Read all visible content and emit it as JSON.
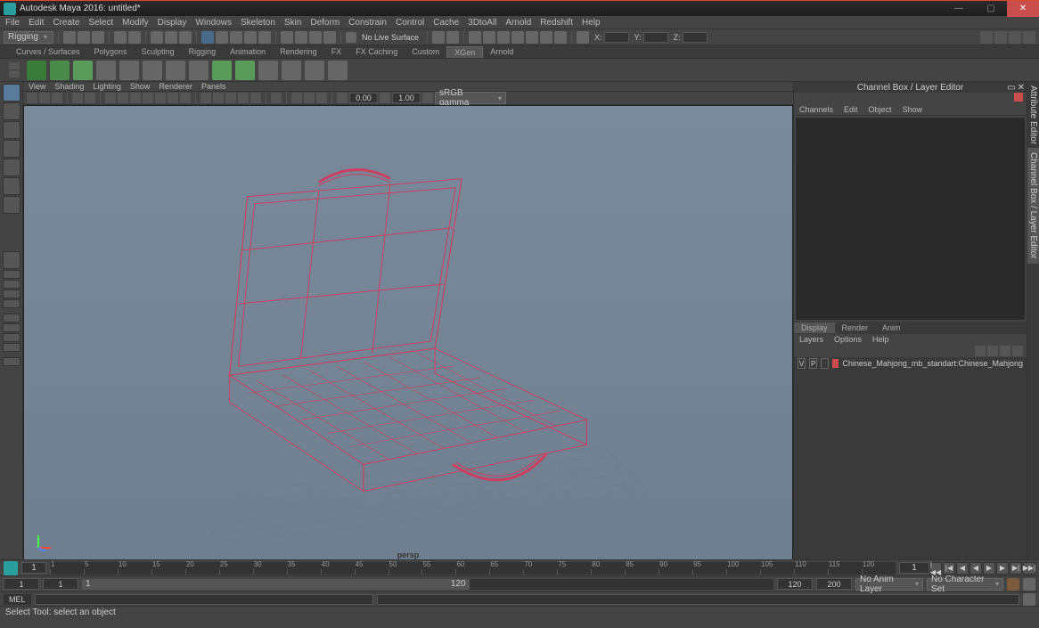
{
  "title": "Autodesk Maya 2016: untitled*",
  "menus": [
    "File",
    "Edit",
    "Create",
    "Select",
    "Modify",
    "Display",
    "Windows",
    "Skeleton",
    "Skin",
    "Deform",
    "Constrain",
    "Control",
    "Cache",
    "3DtoAll",
    "Arnold",
    "Redshift",
    "Help"
  ],
  "mode": "Rigging",
  "surfaceLabel": "No Live Surface",
  "xyz": {
    "x": "X:",
    "y": "Y:",
    "z": "Z:"
  },
  "shelves": [
    "Curves / Surfaces",
    "Polygons",
    "Sculpting",
    "Rigging",
    "Animation",
    "Rendering",
    "FX",
    "FX Caching",
    "Custom",
    "XGen",
    "Arnold"
  ],
  "shelfActive": "XGen",
  "panelMenus": [
    "View",
    "Shading",
    "Lighting",
    "Show",
    "Renderer",
    "Panels"
  ],
  "viewtb": {
    "f1": "0.00",
    "f2": "1.00",
    "gamma": "sRGB gamma"
  },
  "camera": "persp",
  "channelBox": {
    "title": "Channel Box / Layer Editor",
    "menus": [
      "Channels",
      "Edit",
      "Object",
      "Show"
    ]
  },
  "displayTabs": [
    "Display",
    "Render",
    "Anim"
  ],
  "layerMenus": [
    "Layers",
    "Options",
    "Help"
  ],
  "layer": {
    "v": "V",
    "p": "P",
    "name": "Chinese_Mahjong_mb_standart:Chinese_Mahjong"
  },
  "sideTabs": [
    "Attribute Editor",
    "Channel Box / Layer Editor"
  ],
  "timeline": {
    "ticks": [
      "1",
      "5",
      "10",
      "15",
      "20",
      "25",
      "30",
      "35",
      "40",
      "45",
      "50",
      "55",
      "60",
      "65",
      "70",
      "75",
      "80",
      "85",
      "90",
      "95",
      "100",
      "105",
      "110",
      "115",
      "120"
    ],
    "frameField": "1"
  },
  "range": {
    "startOuter": "1",
    "startInner": "1",
    "endInner": "120",
    "endOuter": "200",
    "rh1": "1",
    "rh2": "120",
    "animLayer": "No Anim Layer",
    "charSet": "No Character Set"
  },
  "cmd": {
    "label": "MEL"
  },
  "status": "Select Tool: select an object"
}
